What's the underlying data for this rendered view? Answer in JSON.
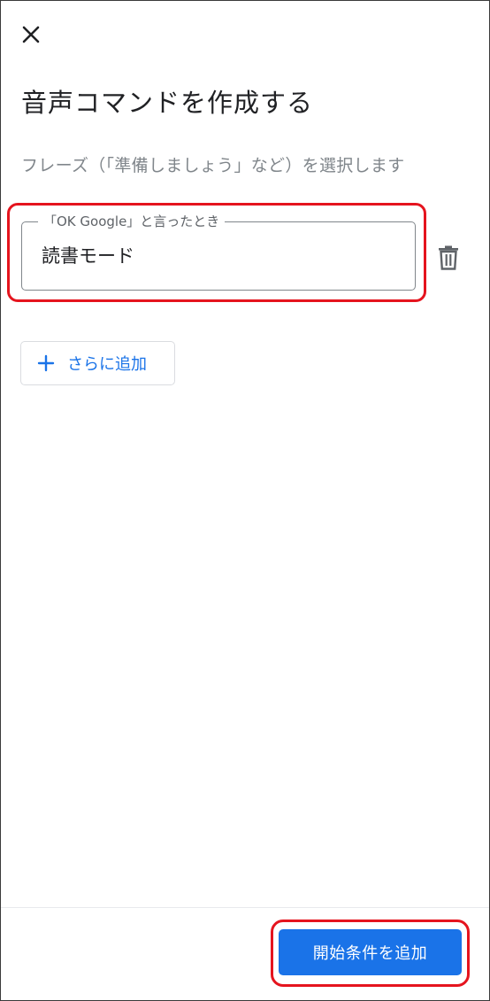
{
  "header": {
    "close_icon": "close-icon",
    "title": "音声コマンドを作成する"
  },
  "instructions": {
    "subtitle": "フレーズ（「準備しましょう」など）を選択します"
  },
  "phrase_field": {
    "label": "「OK Google」と言ったとき",
    "value": "読書モード",
    "delete_icon": "trash-icon"
  },
  "add_more": {
    "icon": "plus-icon",
    "label": "さらに追加"
  },
  "footer": {
    "cta_label": "開始条件を追加"
  },
  "colors": {
    "accent": "#1a73e8",
    "highlight": "#e5141e",
    "text_primary": "#202124",
    "text_secondary": "#80868b"
  }
}
